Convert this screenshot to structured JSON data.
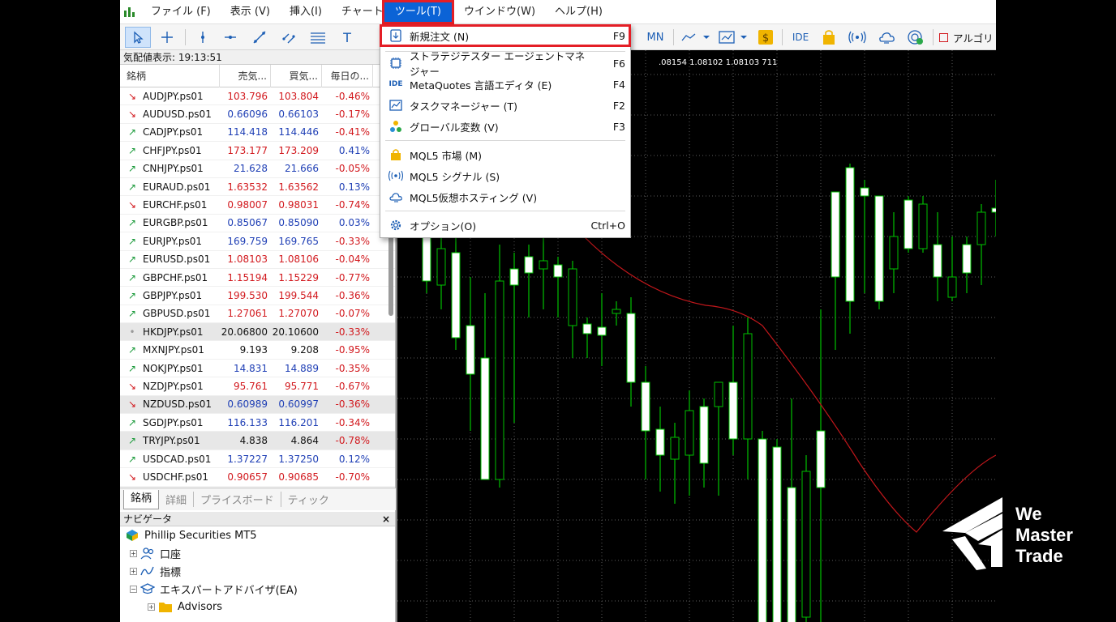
{
  "menubar": {
    "items": [
      "ファイル (F)",
      "表示 (V)",
      "挿入(I)",
      "チャート (C",
      "ツール(T)",
      "ウインドウ(W)",
      "ヘルプ(H)"
    ]
  },
  "toolbar": {
    "timeframe": "MN",
    "ide": "IDE",
    "algo": "アルゴリ"
  },
  "market_watch": {
    "title": "気配値表示: 19:13:51",
    "headers": [
      "銘柄",
      "売気...",
      "買気...",
      "毎日の..."
    ],
    "rows": [
      {
        "symbol": "AUDJPY.ps01",
        "bid": "103.796",
        "ask": "103.804",
        "change": "-0.46%",
        "dir": "down",
        "color": "red"
      },
      {
        "symbol": "AUDUSD.ps01",
        "bid": "0.66096",
        "ask": "0.66103",
        "change": "-0.17%",
        "dir": "down",
        "color": "blue"
      },
      {
        "symbol": "CADJPY.ps01",
        "bid": "114.418",
        "ask": "114.446",
        "change": "-0.41%",
        "dir": "up",
        "color": "blue"
      },
      {
        "symbol": "CHFJPY.ps01",
        "bid": "173.177",
        "ask": "173.209",
        "change": "0.41%",
        "dir": "up",
        "color": "red"
      },
      {
        "symbol": "CNHJPY.ps01",
        "bid": "21.628",
        "ask": "21.666",
        "change": "-0.05%",
        "dir": "up",
        "color": "blue"
      },
      {
        "symbol": "EURAUD.ps01",
        "bid": "1.63532",
        "ask": "1.63562",
        "change": "0.13%",
        "dir": "up",
        "color": "red"
      },
      {
        "symbol": "EURCHF.ps01",
        "bid": "0.98007",
        "ask": "0.98031",
        "change": "-0.74%",
        "dir": "down",
        "color": "red"
      },
      {
        "symbol": "EURGBP.ps01",
        "bid": "0.85067",
        "ask": "0.85090",
        "change": "0.03%",
        "dir": "up",
        "color": "blue"
      },
      {
        "symbol": "EURJPY.ps01",
        "bid": "169.759",
        "ask": "169.765",
        "change": "-0.33%",
        "dir": "up",
        "color": "blue"
      },
      {
        "symbol": "EURUSD.ps01",
        "bid": "1.08103",
        "ask": "1.08106",
        "change": "-0.04%",
        "dir": "up",
        "color": "red"
      },
      {
        "symbol": "GBPCHF.ps01",
        "bid": "1.15194",
        "ask": "1.15229",
        "change": "-0.77%",
        "dir": "up",
        "color": "red"
      },
      {
        "symbol": "GBPJPY.ps01",
        "bid": "199.530",
        "ask": "199.544",
        "change": "-0.36%",
        "dir": "up",
        "color": "red"
      },
      {
        "symbol": "GBPUSD.ps01",
        "bid": "1.27061",
        "ask": "1.27070",
        "change": "-0.07%",
        "dir": "up",
        "color": "red"
      },
      {
        "symbol": "HKDJPY.ps01",
        "bid": "20.06800",
        "ask": "20.10600",
        "change": "-0.33%",
        "dir": "flat",
        "color": "black"
      },
      {
        "symbol": "MXNJPY.ps01",
        "bid": "9.193",
        "ask": "9.208",
        "change": "-0.95%",
        "dir": "up",
        "color": "black"
      },
      {
        "symbol": "NOKJPY.ps01",
        "bid": "14.831",
        "ask": "14.889",
        "change": "-0.35%",
        "dir": "up",
        "color": "blue"
      },
      {
        "symbol": "NZDJPY.ps01",
        "bid": "95.761",
        "ask": "95.771",
        "change": "-0.67%",
        "dir": "down",
        "color": "red"
      },
      {
        "symbol": "NZDUSD.ps01",
        "bid": "0.60989",
        "ask": "0.60997",
        "change": "-0.36%",
        "dir": "down",
        "color": "blue"
      },
      {
        "symbol": "SGDJPY.ps01",
        "bid": "116.133",
        "ask": "116.201",
        "change": "-0.34%",
        "dir": "up",
        "color": "blue"
      },
      {
        "symbol": "TRYJPY.ps01",
        "bid": "4.838",
        "ask": "4.864",
        "change": "-0.78%",
        "dir": "up",
        "color": "black"
      },
      {
        "symbol": "USDCAD.ps01",
        "bid": "1.37227",
        "ask": "1.37250",
        "change": "0.12%",
        "dir": "up",
        "color": "blue"
      },
      {
        "symbol": "USDCHF.ps01",
        "bid": "0.90657",
        "ask": "0.90685",
        "change": "-0.70%",
        "dir": "down",
        "color": "red"
      }
    ],
    "grey_rows": [
      13,
      17,
      19
    ],
    "tabs": [
      "銘柄",
      "詳細",
      "プライスボード",
      "ティック"
    ]
  },
  "navigator": {
    "title": "ナビゲータ",
    "close": "×",
    "items": [
      "Phillip Securities MT5",
      "口座",
      "指標",
      "エキスパートアドバイザ(EA)",
      "Advisors"
    ]
  },
  "chart": {
    "header": ".08154 1.08102 1.08103 711"
  },
  "dropdown": {
    "items": [
      {
        "label": "新規注文 (N)",
        "shortcut": "F9",
        "icon": "new-order-icon"
      },
      {
        "label": "ストラテジテスター エージェントマネジャー",
        "shortcut": "F6",
        "icon": "chip-icon"
      },
      {
        "label": "MetaQuotes 言語エディタ (E)",
        "shortcut": "F4",
        "icon": "ide-icon",
        "icon_text": "IDE"
      },
      {
        "label": "タスクマネージャー (T)",
        "shortcut": "F2",
        "icon": "task-manager-icon"
      },
      {
        "label": "グローバル変数 (V)",
        "shortcut": "F3",
        "icon": "global-vars-icon"
      },
      {
        "label": "MQL5 市場 (M)",
        "shortcut": "",
        "icon": "market-bag-icon"
      },
      {
        "label": "MQL5 シグナル (S)",
        "shortcut": "",
        "icon": "signal-icon"
      },
      {
        "label": "MQL5仮想ホスティング (V)",
        "shortcut": "",
        "icon": "cloud-icon"
      },
      {
        "label": "オプション(O)",
        "shortcut": "Ctrl+O",
        "icon": "gear-icon"
      }
    ]
  },
  "watermark": {
    "lines": [
      "We",
      "Master",
      "Trade"
    ]
  },
  "colors": {
    "highlight": "#e41e26",
    "menu_active": "#0b63d6",
    "bull_candle": "#ffffff",
    "wick": "#00c000",
    "ma_line": "#c0171b"
  }
}
